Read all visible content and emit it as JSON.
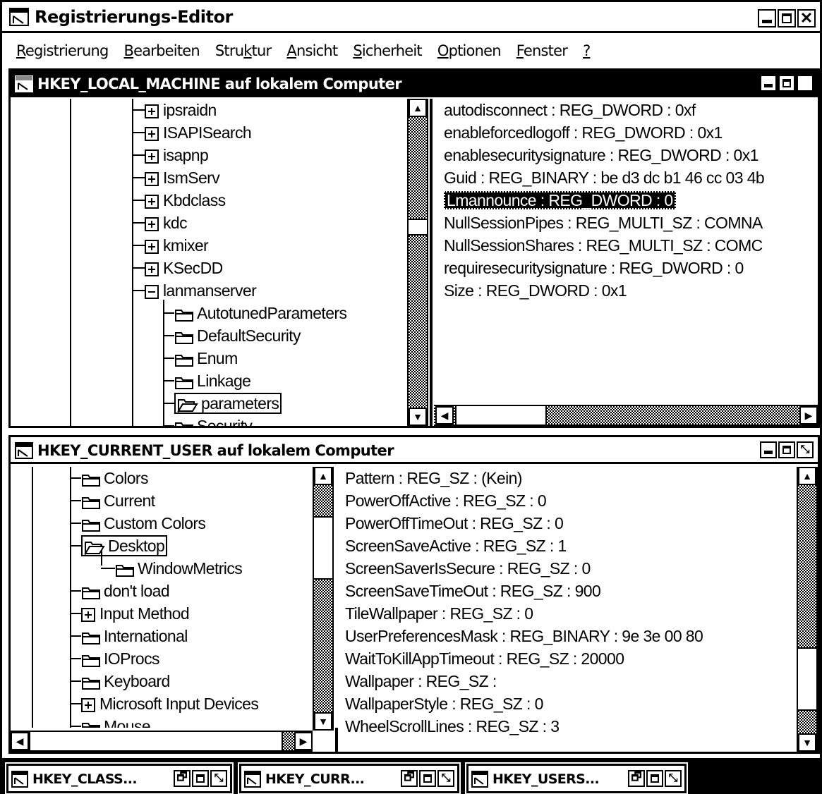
{
  "app": {
    "title": "Registrierungs-Editor"
  },
  "menu": [
    "Registrierung",
    "Bearbeiten",
    "Struktur",
    "Ansicht",
    "Sicherheit",
    "Optionen",
    "Fenster",
    "?"
  ],
  "window_top": {
    "title": "HKEY_LOCAL_MACHINE auf lokalem Computer",
    "tree": [
      {
        "label": "ipsraidn",
        "icon": "plus-box-icon"
      },
      {
        "label": "ISAPISearch",
        "icon": "plus-box-icon"
      },
      {
        "label": "isapnp",
        "icon": "plus-box-icon"
      },
      {
        "label": "IsmServ",
        "icon": "plus-box-icon"
      },
      {
        "label": "Kbdclass",
        "icon": "plus-box-icon"
      },
      {
        "label": "kdc",
        "icon": "plus-box-icon"
      },
      {
        "label": "kmixer",
        "icon": "plus-box-icon"
      },
      {
        "label": "KSecDD",
        "icon": "plus-box-icon"
      },
      {
        "label": "lanmanserver",
        "icon": "minus-box-icon"
      },
      {
        "label": "AutotunedParameters",
        "icon": "folder-icon"
      },
      {
        "label": "DefaultSecurity",
        "icon": "folder-icon"
      },
      {
        "label": "Enum",
        "icon": "folder-icon"
      },
      {
        "label": "Linkage",
        "icon": "folder-icon"
      },
      {
        "label": "parameters",
        "icon": "open-folder-icon"
      },
      {
        "label": "Security",
        "icon": "folder-icon"
      }
    ],
    "values": [
      "autodisconnect : REG_DWORD : 0xf",
      "enableforcedlogoff : REG_DWORD : 0x1",
      "enablesecuritysignature : REG_DWORD : 0x1",
      "Guid : REG_BINARY : be d3 dc b1 46 cc 03 4b",
      "Lmannounce : REG_DWORD : 0",
      "NullSessionPipes : REG_MULTI_SZ : COMNA",
      "NullSessionShares : REG_MULTI_SZ : COMC",
      "requiresecuritysignature : REG_DWORD : 0",
      "Size : REG_DWORD : 0x1"
    ]
  },
  "window_bottom": {
    "title": "HKEY_CURRENT_USER auf lokalem Computer",
    "tree": [
      {
        "label": "Colors",
        "icon": "folder-icon"
      },
      {
        "label": "Current",
        "icon": "folder-icon"
      },
      {
        "label": "Custom Colors",
        "icon": "folder-icon"
      },
      {
        "label": "Desktop",
        "icon": "open-folder-icon"
      },
      {
        "label": "WindowMetrics",
        "icon": "folder-icon"
      },
      {
        "label": "don't load",
        "icon": "folder-icon"
      },
      {
        "label": "Input Method",
        "icon": "plus-box-icon"
      },
      {
        "label": "International",
        "icon": "folder-icon"
      },
      {
        "label": "IOProcs",
        "icon": "folder-icon"
      },
      {
        "label": "Keyboard",
        "icon": "folder-icon"
      },
      {
        "label": "Microsoft Input Devices",
        "icon": "plus-box-icon"
      },
      {
        "label": "Mouse",
        "icon": "folder-icon"
      }
    ],
    "values": [
      "Pattern : REG_SZ : (Kein)",
      "PowerOffActive : REG_SZ : 0",
      "PowerOffTimeOut : REG_SZ : 0",
      "ScreenSaveActive : REG_SZ : 1",
      "ScreenSaverIsSecure : REG_SZ : 0",
      "ScreenSaveTimeOut : REG_SZ : 900",
      "TileWallpaper : REG_SZ : 0",
      "UserPreferencesMask : REG_BINARY : 9e 3e 00 80",
      "WaitToKillAppTimeout : REG_SZ : 20000",
      "Wallpaper : REG_SZ :",
      "WallpaperStyle : REG_SZ : 0",
      "WheelScrollLines : REG_SZ : 3"
    ]
  },
  "minimized": [
    "HKEY_CLASS...",
    "HKEY_CURR...",
    "HKEY_USERS..."
  ]
}
